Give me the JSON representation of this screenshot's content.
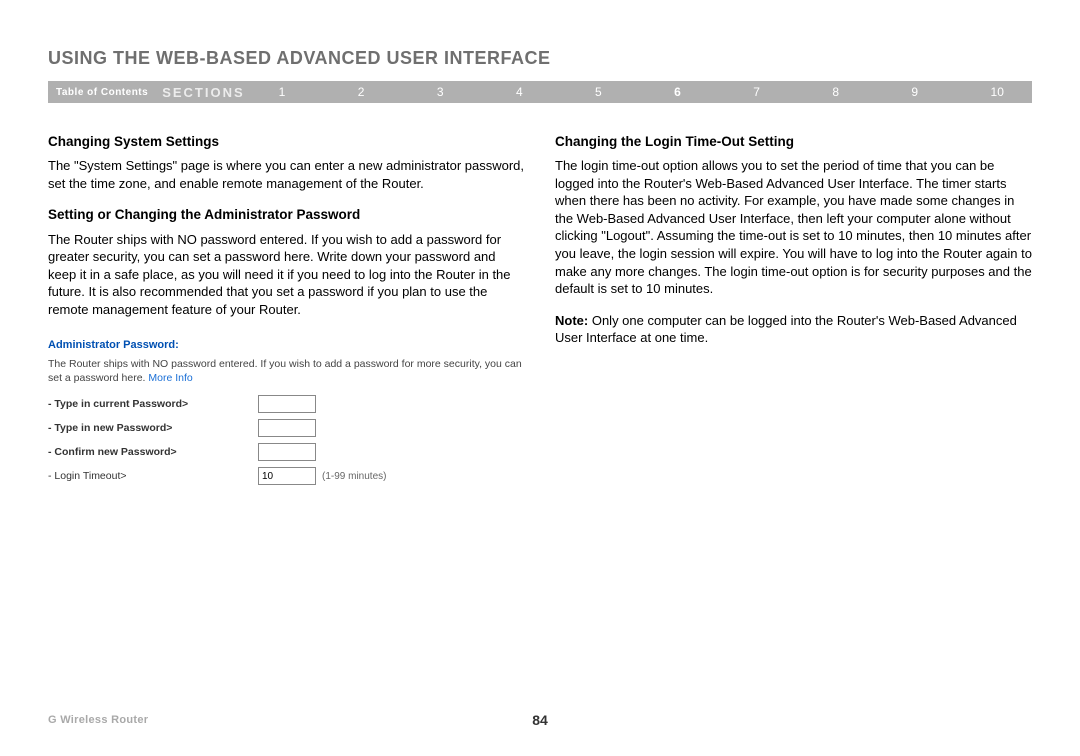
{
  "header": {
    "title": "USING THE WEB-BASED ADVANCED USER INTERFACE"
  },
  "nav": {
    "toc": "Table of Contents",
    "sections_label": "SECTIONS",
    "items": [
      "1",
      "2",
      "3",
      "4",
      "5",
      "6",
      "7",
      "8",
      "9",
      "10"
    ],
    "active": "6"
  },
  "left": {
    "h1": "Changing System Settings",
    "p1": "The \"System Settings\" page is where you can enter a new administrator password, set the time zone, and enable remote management of the Router.",
    "h2": "Setting or Changing the Administrator Password",
    "p2": "The Router ships with NO password entered. If you wish to add a password for greater security, you can set a password here. Write down your password and keep it in a safe place, as you will need it if you need to log into the Router in the future. It is also recommended that you set a password if you plan to use the remote management feature of your Router."
  },
  "panel": {
    "title": "Administrator Password:",
    "desc": "The Router ships with NO password entered. If you wish to add a password for more security, you can set a password here. ",
    "more": "More Info",
    "rows": {
      "current": "- Type in current Password>",
      "newp": "- Type in new Password>",
      "confirm": "- Confirm new Password>",
      "timeout": "- Login Timeout>",
      "timeout_value": "10",
      "timeout_hint": "(1-99 minutes)"
    }
  },
  "right": {
    "h1": "Changing the Login Time-Out Setting",
    "p1": "The login time-out option allows you to set the period of time that you can be logged into the Router's Web-Based Advanced User Interface. The timer starts when there has been no activity. For example, you have made some changes in the Web-Based Advanced User Interface, then left your computer alone without clicking \"Logout\". Assuming the time-out is set to 10 minutes, then 10 minutes after you leave, the login session will expire. You will have to log into the Router again to make any more changes. The login time-out option is for security purposes and the default is set to 10 minutes.",
    "note_label": "Note: ",
    "note_body": "Only one computer can be logged into the Router's Web-Based Advanced User Interface at one time."
  },
  "footer": {
    "product": "G Wireless Router",
    "page": "84"
  }
}
